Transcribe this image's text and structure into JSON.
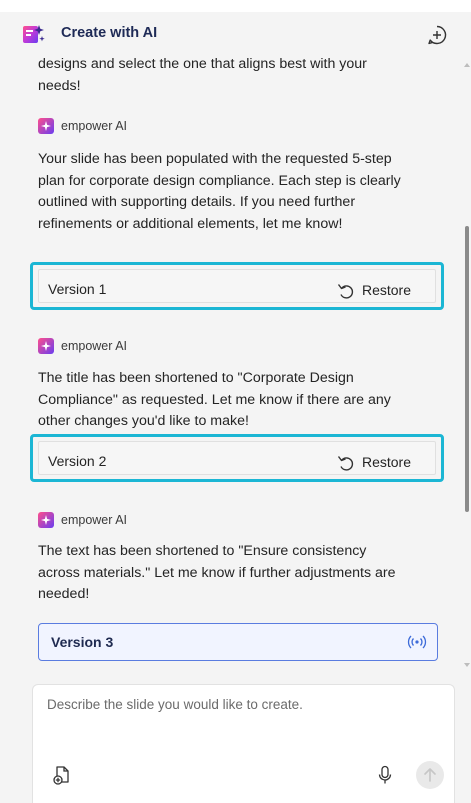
{
  "header": {
    "title": "Create with AI"
  },
  "messages": {
    "intro_tail": "designs and select the one that aligns best with your needs!",
    "ai_name": "empower AI",
    "msg1": "Your slide has been populated with the requested 5-step plan for corporate design compliance. Each step is clearly outlined with supporting details. If you need further refinements or additional elements, let me know!",
    "msg2": "The title has been shortened to \"Corporate Design Compliance\" as requested. Let me know if there are any other changes you'd like to make!",
    "msg3": "The text has been shortened to \"Ensure consistency across materials.\" Let me know if further adjustments are needed!"
  },
  "versions": [
    {
      "label": "Version 1",
      "action": "Restore"
    },
    {
      "label": "Version 2",
      "action": "Restore"
    },
    {
      "label": "Version 3"
    }
  ],
  "composer": {
    "placeholder": "Describe the slide you would like to create."
  },
  "colors": {
    "accent_highlight": "#1bb6d4",
    "title_text": "#1e2a56",
    "active_version_border": "#5a7ce0"
  },
  "icons": {
    "logo": "create-with-ai-logo-icon",
    "new_chat": "new-chat-icon",
    "ai_badge": "empower-ai-icon",
    "restore": "restore-icon",
    "live": "live-broadcast-icon",
    "attach": "attach-file-icon",
    "mic": "microphone-icon",
    "send": "send-arrow-icon"
  }
}
